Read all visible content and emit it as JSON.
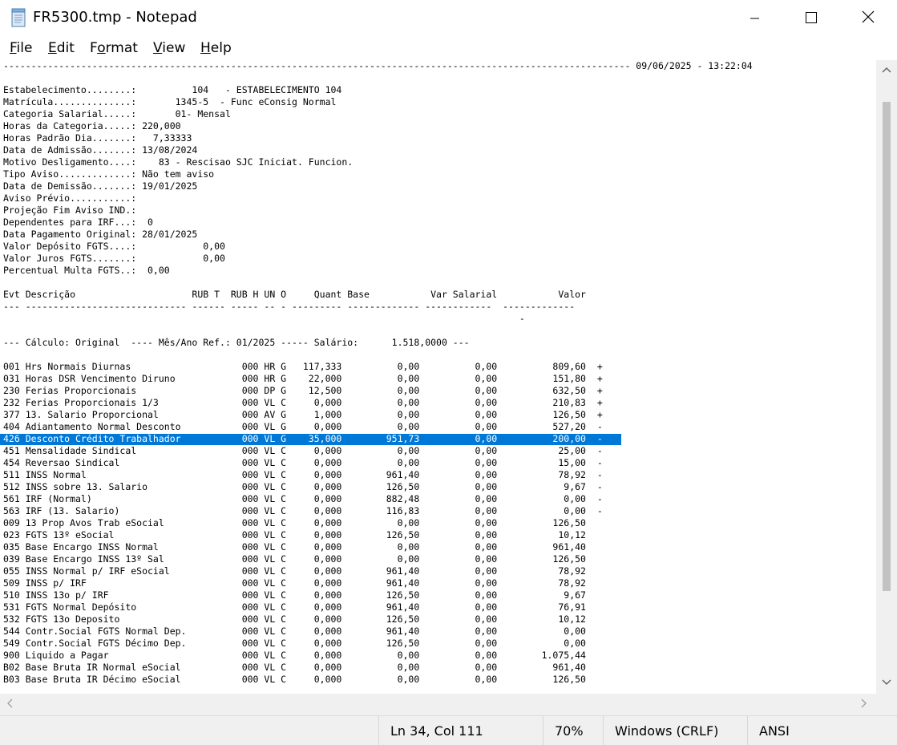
{
  "window": {
    "title": "FR5300.tmp - Notepad",
    "controls": {
      "minimize": "—",
      "maximize": "☐",
      "close": "✕"
    }
  },
  "menu": [
    {
      "pre": "",
      "acc": "F",
      "post": "ile"
    },
    {
      "pre": "",
      "acc": "E",
      "post": "dit"
    },
    {
      "pre": "F",
      "acc": "o",
      "post": "rmat"
    },
    {
      "pre": "",
      "acc": "V",
      "post": "iew"
    },
    {
      "pre": "",
      "acc": "H",
      "post": "elp"
    }
  ],
  "document": {
    "lines": [
      "----------------------------------------------------------------------------------------------------------------- 09/06/2025 - 13:22:04",
      "",
      "Estabelecimento........:          104   - ESTABELECIMENTO 104",
      "Matrícula..............:       1345-5  - Func eConsig Normal",
      "Categoria Salarial.....:       01- Mensal",
      "Horas da Categoria.....: 220,000",
      "Horas Padrão Dia.......:   7,33333",
      "Data de Admissão.......: 13/08/2024",
      "Motivo Desligamento....:    83 - Rescisao SJC Iniciat. Funcion.",
      "Tipo Aviso.............: Não tem aviso",
      "Data de Demissão.......: 19/01/2025",
      "Aviso Prévio...........:",
      "Projeção Fim Aviso IND.:",
      "Dependentes para IRF...:  0",
      "Data Pagamento Original: 28/01/2025",
      "Valor Depósito FGTS....:            0,00",
      "Valor Juros FGTS.......:            0,00",
      "Percentual Multa FGTS..:  0,00",
      "",
      "Evt Descrição                     RUB T  RUB H UN O     Quant Base           Var Salarial           Valor",
      "--- ----------------------------- ------ ----- -- - --------- ------------- ------------  -------------",
      "                                                                                             -",
      "",
      "--- Cálculo: Original  ---- Mês/Ano Ref.: 01/2025 ----- Salário:      1.518,0000 ---",
      "",
      "001 Hrs Normais Diurnas                    000 HR G   117,333          0,00          0,00          809,60  +",
      "031 Horas DSR Vencimento Diruno            000 HR G    22,000          0,00          0,00          151,80  +",
      "230 Ferias Proporcionais                   000 DP G    12,500          0,00          0,00          632,50  +",
      "232 Ferias Proporcionais 1/3               000 VL C     0,000          0,00          0,00          210,83  +",
      "377 13. Salario Proporcional               000 AV G     1,000          0,00          0,00          126,50  +",
      "404 Adiantamento Normal Desconto           000 VL G     0,000          0,00          0,00          527,20  -",
      "426 Desconto Crédito Trabalhador           000 VL G    35,000        951,73          0,00          200,00  -",
      "451 Mensalidade Sindical                   000 VL C     0,000          0,00          0,00           25,00  -",
      "454 Reversao Sindical                      000 VL C     0,000          0,00          0,00           15,00  -",
      "511 INSS Normal                            000 VL C     0,000        961,40          0,00           78,92  -",
      "512 INSS sobre 13. Salario                 000 VL C     0,000        126,50          0,00            9,67  -",
      "561 IRF (Normal)                           000 VL C     0,000        882,48          0,00            0,00  -",
      "563 IRF (13. Salario)                      000 VL C     0,000        116,83          0,00            0,00  -",
      "009 13 Prop Avos Trab eSocial              000 VL C     0,000          0,00          0,00          126,50",
      "023 FGTS 13º eSocial                       000 VL C     0,000        126,50          0,00           10,12",
      "035 Base Encargo INSS Normal               000 VL C     0,000          0,00          0,00          961,40",
      "039 Base Encargo INSS 13º Sal              000 VL C     0,000          0,00          0,00          126,50",
      "055 INSS Normal p/ IRF eSocial             000 VL C     0,000        961,40          0,00           78,92",
      "509 INSS p/ IRF                            000 VL C     0,000        961,40          0,00           78,92",
      "510 INSS 13o p/ IRF                        000 VL C     0,000        126,50          0,00            9,67",
      "531 FGTS Normal Depósito                   000 VL C     0,000        961,40          0,00           76,91",
      "532 FGTS 13o Deposito                      000 VL C     0,000        126,50          0,00           10,12",
      "544 Contr.Social FGTS Normal Dep.          000 VL C     0,000        961,40          0,00            0,00",
      "549 Contr.Social FGTS Décimo Dep.          000 VL C     0,000        126,50          0,00            0,00",
      "900 Liquido a Pagar                        000 VL C     0,000          0,00          0,00        1.075,44",
      "B02 Base Bruta IR Normal eSocial           000 VL C     0,000          0,00          0,00          961,40",
      "B03 Base Bruta IR Décimo eSocial           000 VL C     0,000          0,00          0,00          126,50"
    ],
    "selected_line_index": 31
  },
  "statusbar": {
    "position": "Ln 34, Col 111",
    "zoom": "70%",
    "line_ending": "Windows (CRLF)",
    "encoding": "ANSI"
  },
  "colors": {
    "selection": "#0078d7",
    "scrollbar_track": "#f0f0f0",
    "scrollbar_thumb": "#c2c2c2"
  }
}
